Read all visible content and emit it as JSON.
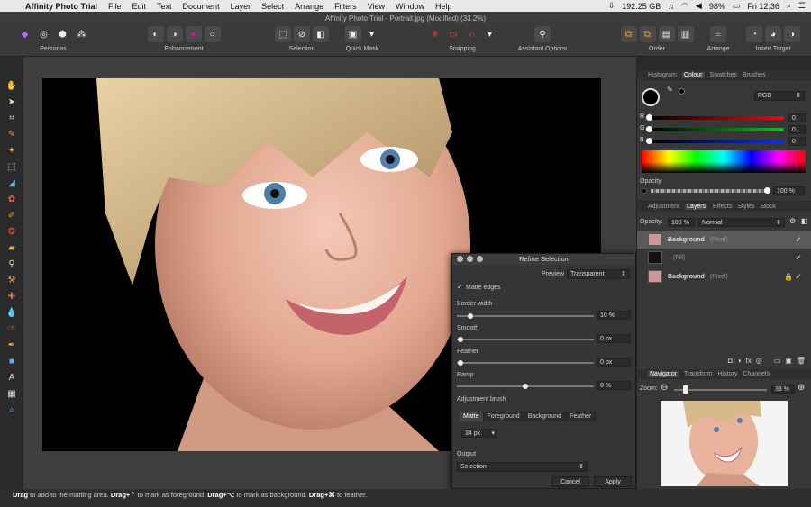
{
  "menubar": {
    "app": "Affinity Photo Trial",
    "items": [
      "File",
      "Edit",
      "Text",
      "Document",
      "Layer",
      "Select",
      "Arrange",
      "Filters",
      "View",
      "Window",
      "Help"
    ],
    "disk": "192.25 GB",
    "battery": "98%",
    "clock": "Fri 12:36"
  },
  "window": {
    "title": "Affinity Photo Trial - Portrait.jpg (Modified) (33.2%)"
  },
  "toolbar": {
    "personas": "Personas",
    "enhancement": "Enhancement",
    "selection": "Selection",
    "quick_mask": "Quick Mask",
    "snapping": "Snapping",
    "assistant": "Assistant Options",
    "order": "Order",
    "arrange": "Arrange",
    "insert_target": "Insert Target"
  },
  "colour_panel": {
    "tabs": [
      "Histogram",
      "Colour",
      "Swatches",
      "Brushes"
    ],
    "active_tab": "Colour",
    "mode": "RGB",
    "r_label": "R",
    "g_label": "G",
    "b_label": "B",
    "r_value": "0",
    "g_value": "0",
    "b_value": "0",
    "opacity_label": "Opacity",
    "opacity_value": "100 %",
    "colors": {
      "r": "#e01010",
      "g": "#10c020",
      "b": "#1030e0"
    }
  },
  "layers_panel": {
    "tabs": [
      "Adjustment",
      "Layers",
      "Effects",
      "Styles",
      "Stock"
    ],
    "active_tab": "Layers",
    "opacity_label": "Opacity:",
    "opacity_value": "100 %",
    "blend": "Normal",
    "layers": [
      {
        "name": "Background",
        "type": "(Pixel)"
      },
      {
        "name": "",
        "type": "(Fill)"
      },
      {
        "name": "Background",
        "type": "(Pixel)"
      }
    ]
  },
  "navigator": {
    "tabs": [
      "Navigator",
      "Transform",
      "History",
      "Channels"
    ],
    "active_tab": "Navigator",
    "zoom_label": "Zoom:",
    "zoom_value": "33 %"
  },
  "refine": {
    "title": "Refine Selection",
    "preview_label": "Preview",
    "preview_value": "Transparent",
    "matte_label": "Matte edges",
    "matte_checked": true,
    "border_label": "Border width",
    "border_value": "10 %",
    "border_level": 0.1,
    "smooth_label": "Smooth",
    "smooth_value": "0 px",
    "smooth_level": 0,
    "feather_label": "Feather",
    "feather_value": "0 px",
    "feather_level": 0,
    "ramp_label": "Ramp",
    "ramp_value": "0 %",
    "ramp_level": 0.5,
    "brush_label": "Adjustment brush",
    "brush_modes": [
      "Matte",
      "Foreground",
      "Background",
      "Feather"
    ],
    "brush_size": "34 px",
    "output_label": "Output",
    "output_value": "Selection",
    "cancel": "Cancel",
    "apply": "Apply"
  },
  "status": {
    "p1": "Drag",
    "t1": " to add to the matting area. ",
    "p2": "Drag+⌃",
    "t2": " to mark as foreground. ",
    "p3": "Drag+⌥",
    "t3": " to mark as background. ",
    "p4": "Drag+⌘",
    "t4": " to feather."
  }
}
